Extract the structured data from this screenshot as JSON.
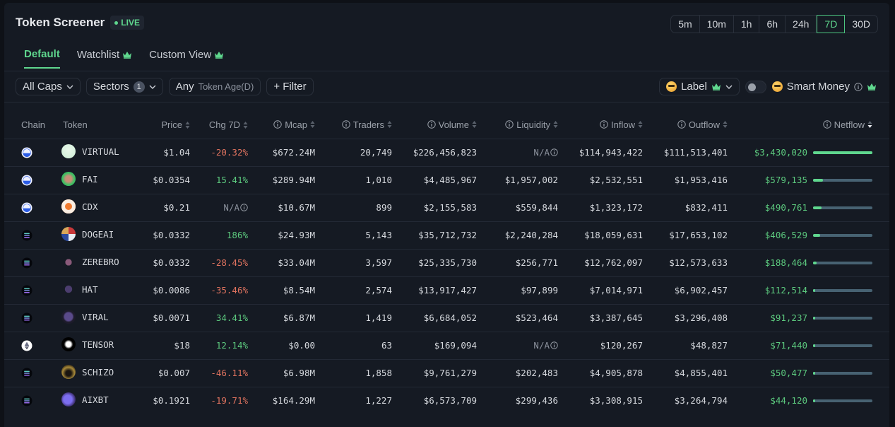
{
  "header": {
    "title": "Token Screener",
    "live_label": "LIVE"
  },
  "timeframes": [
    "5m",
    "10m",
    "1h",
    "6h",
    "24h",
    "7D",
    "30D"
  ],
  "active_timeframe": "7D",
  "tabs": [
    {
      "label": "Default",
      "active": true,
      "premium": false
    },
    {
      "label": "Watchlist",
      "active": false,
      "premium": true
    },
    {
      "label": "Custom View",
      "active": false,
      "premium": true
    }
  ],
  "filters": {
    "caps": "All Caps",
    "sectors": "Sectors",
    "sectors_count": "1",
    "age_value": "Any",
    "age_label": "Token Age(D)",
    "add_filter": "+ Filter",
    "label": "Label",
    "smart_money": "Smart Money",
    "smart_money_enabled": false
  },
  "colors": {
    "accent": "#5fd78e",
    "negative": "#e0735f",
    "positive": "#5cc97e"
  },
  "table": {
    "columns": [
      {
        "label": "Chain",
        "info": false,
        "sortable": false
      },
      {
        "label": "Token",
        "info": false,
        "sortable": false
      },
      {
        "label": "Price",
        "info": false,
        "sortable": true
      },
      {
        "label": "Chg 7D",
        "info": false,
        "sortable": true
      },
      {
        "label": "Mcap",
        "info": true,
        "sortable": true
      },
      {
        "label": "Traders",
        "info": true,
        "sortable": true
      },
      {
        "label": "Volume",
        "info": true,
        "sortable": true
      },
      {
        "label": "Liquidity",
        "info": true,
        "sortable": true
      },
      {
        "label": "Inflow",
        "info": true,
        "sortable": true
      },
      {
        "label": "Outflow",
        "info": true,
        "sortable": true
      },
      {
        "label": "Netflow",
        "info": true,
        "sortable": true,
        "sorted": "desc"
      }
    ],
    "rows": [
      {
        "chain": "base",
        "token": "VIRTUAL",
        "icon": "virtual",
        "price": "$1.04",
        "chg": "-20.32%",
        "chg_dir": "neg",
        "mcap": "$672.24M",
        "traders": "20,749",
        "volume": "$226,456,823",
        "liquidity": "N/A",
        "inflow": "$114,943,422",
        "outflow": "$111,513,401",
        "netflow": "$3,430,020",
        "netflow_ratio": 1.0
      },
      {
        "chain": "base",
        "token": "FAI",
        "icon": "fai",
        "price": "$0.0354",
        "chg": "15.41%",
        "chg_dir": "pos",
        "mcap": "$289.94M",
        "traders": "1,010",
        "volume": "$4,485,967",
        "liquidity": "$1,957,002",
        "inflow": "$2,532,551",
        "outflow": "$1,953,416",
        "netflow": "$579,135",
        "netflow_ratio": 0.17
      },
      {
        "chain": "base",
        "token": "CDX",
        "icon": "cdx",
        "price": "$0.21",
        "chg": "N/A",
        "chg_dir": "na",
        "mcap": "$10.67M",
        "traders": "899",
        "volume": "$2,155,583",
        "liquidity": "$559,844",
        "inflow": "$1,323,172",
        "outflow": "$832,411",
        "netflow": "$490,761",
        "netflow_ratio": 0.143
      },
      {
        "chain": "solana",
        "token": "DOGEAI",
        "icon": "dogeai",
        "price": "$0.0332",
        "chg": "186%",
        "chg_dir": "pos",
        "mcap": "$24.93M",
        "traders": "5,143",
        "volume": "$35,712,732",
        "liquidity": "$2,240,284",
        "inflow": "$18,059,631",
        "outflow": "$17,653,102",
        "netflow": "$406,529",
        "netflow_ratio": 0.119
      },
      {
        "chain": "solana",
        "token": "ZEREBRO",
        "icon": "zerebro",
        "price": "$0.0332",
        "chg": "-28.45%",
        "chg_dir": "neg",
        "mcap": "$33.04M",
        "traders": "3,597",
        "volume": "$25,335,730",
        "liquidity": "$256,771",
        "inflow": "$12,762,097",
        "outflow": "$12,573,633",
        "netflow": "$188,464",
        "netflow_ratio": 0.055
      },
      {
        "chain": "solana",
        "token": "HAT",
        "icon": "hat",
        "price": "$0.0086",
        "chg": "-35.46%",
        "chg_dir": "neg",
        "mcap": "$8.54M",
        "traders": "2,574",
        "volume": "$13,917,427",
        "liquidity": "$97,899",
        "inflow": "$7,014,971",
        "outflow": "$6,902,457",
        "netflow": "$112,514",
        "netflow_ratio": 0.033
      },
      {
        "chain": "solana",
        "token": "VIRAL",
        "icon": "viral",
        "price": "$0.0071",
        "chg": "34.41%",
        "chg_dir": "pos",
        "mcap": "$6.87M",
        "traders": "1,419",
        "volume": "$6,684,052",
        "liquidity": "$523,464",
        "inflow": "$3,387,645",
        "outflow": "$3,296,408",
        "netflow": "$91,237",
        "netflow_ratio": 0.027
      },
      {
        "chain": "ethereum",
        "token": "TENSOR",
        "icon": "tensor",
        "price": "$18",
        "chg": "12.14%",
        "chg_dir": "pos",
        "mcap": "$0.00",
        "traders": "63",
        "volume": "$169,094",
        "liquidity": "N/A",
        "inflow": "$120,267",
        "outflow": "$48,827",
        "netflow": "$71,440",
        "netflow_ratio": 0.021
      },
      {
        "chain": "solana",
        "token": "SCHIZO",
        "icon": "schizo",
        "price": "$0.007",
        "chg": "-46.11%",
        "chg_dir": "neg",
        "mcap": "$6.98M",
        "traders": "1,858",
        "volume": "$9,761,279",
        "liquidity": "$202,483",
        "inflow": "$4,905,878",
        "outflow": "$4,855,401",
        "netflow": "$50,477",
        "netflow_ratio": 0.015
      },
      {
        "chain": "solana",
        "token": "AIXBT",
        "icon": "aixbt",
        "price": "$0.1921",
        "chg": "-19.71%",
        "chg_dir": "neg",
        "mcap": "$164.29M",
        "traders": "1,227",
        "volume": "$6,573,709",
        "liquidity": "$299,436",
        "inflow": "$3,308,915",
        "outflow": "$3,264,794",
        "netflow": "$44,120",
        "netflow_ratio": 0.013
      }
    ]
  }
}
